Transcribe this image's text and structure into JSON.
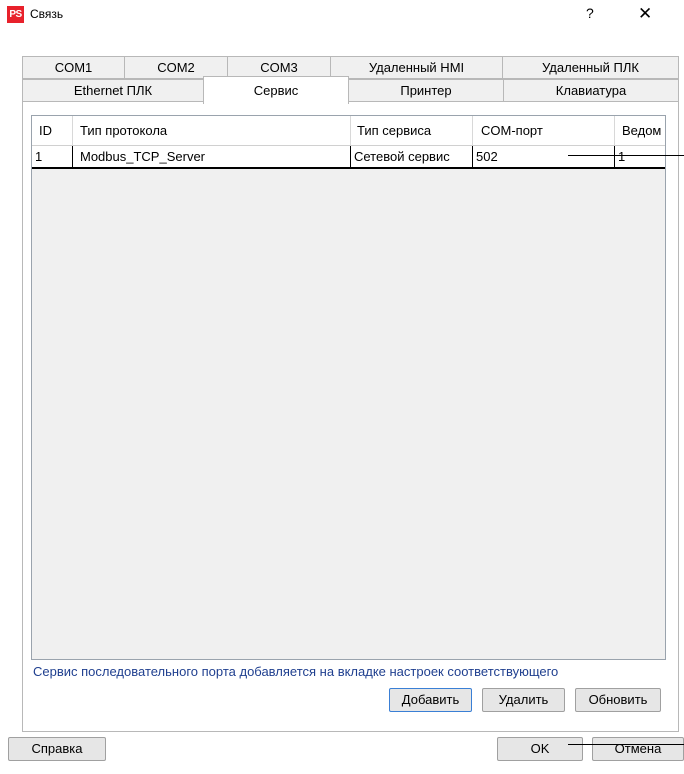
{
  "window": {
    "logo_text": "PS",
    "title": "Связь",
    "help_symbol": "?",
    "close_symbol": "✕"
  },
  "tabs": {
    "row1": [
      "COM1",
      "COM2",
      "COM3",
      "Удаленный HMI",
      "Удаленный ПЛК"
    ],
    "row2": [
      "Ethernet ПЛК",
      "Сервис",
      "Принтер",
      "Клавиатура"
    ],
    "active": "Сервис"
  },
  "table": {
    "headers": [
      "ID",
      "Тип протокола",
      "Тип сервиса",
      "COM-порт",
      "Ведом"
    ],
    "rows": [
      [
        "1",
        "Modbus_TCP_Server",
        "Сетевой сервис",
        "502",
        "1"
      ]
    ]
  },
  "note": "Сервис последовательного порта добавляется на вкладке настроек соответствующего",
  "buttons": {
    "add": "Добавить",
    "delete": "Удалить",
    "refresh": "Обновить",
    "help": "Справка",
    "ok": "OK",
    "cancel": "Отмена"
  }
}
